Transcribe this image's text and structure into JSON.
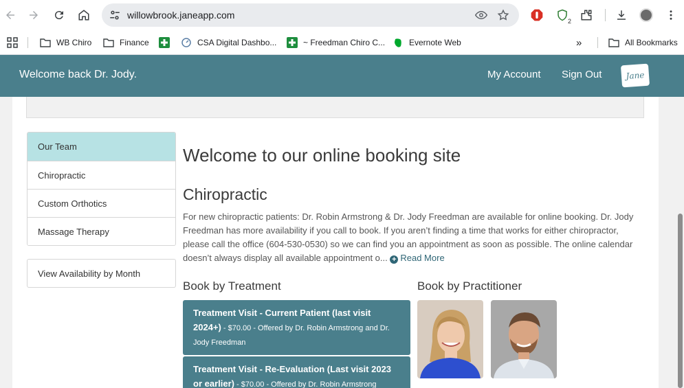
{
  "browser": {
    "url": "willowbrook.janeapp.com",
    "extension_badge": "2",
    "bookmarks": [
      {
        "label": "WB Chiro",
        "icon": "folder-icon"
      },
      {
        "label": "Finance",
        "icon": "folder-icon"
      },
      {
        "label": "",
        "icon": "green-cross-icon"
      },
      {
        "label": "CSA Digital Dashbo...",
        "icon": "dashboard-icon"
      },
      {
        "label": "~ Freedman Chiro C...",
        "icon": "green-cross-icon"
      },
      {
        "label": "Evernote Web",
        "icon": "evernote-icon"
      }
    ],
    "overflow_label": "»",
    "all_bookmarks_label": "All Bookmarks"
  },
  "header": {
    "welcome": "Welcome back Dr. Jody.",
    "my_account": "My Account",
    "sign_out": "Sign Out",
    "logo_text": "Jane",
    "color": "#4a7f8c"
  },
  "sidebar": {
    "items": [
      "Our Team",
      "Chiropractic",
      "Custom Orthotics",
      "Massage Therapy"
    ],
    "active_color": "#b7e2e4",
    "availability_button": "View Availability by Month"
  },
  "main": {
    "title": "Welcome to our online booking site",
    "section_title": "Chiropractic",
    "description": "For new chiropractic patients: Dr. Robin Armstrong & Dr. Jody Freedman are available for online booking. Dr. Jody Freedman has more availability if you call to book. If you aren’t finding a time that works for either chiropractor, please call the office (604-530-0530) so we can find you an appointment as soon as possible. The online calendar doesn’t always display all available appointment o...",
    "read_more": "Read More",
    "book_by_treatment": "Book by Treatment",
    "book_by_practitioner": "Book by Practitioner",
    "treatments": [
      {
        "name": "Treatment Visit - Current Patient (last visit 2024+)",
        "meta": " - $70.00 - Offered by Dr. Robin Armstrong and Dr. Jody Freedman"
      },
      {
        "name": "Treatment Visit - Re-Evaluation (Last visit 2023 or earlier)",
        "meta": " - $70.00 - Offered by Dr. Robin Armstrong"
      }
    ]
  }
}
